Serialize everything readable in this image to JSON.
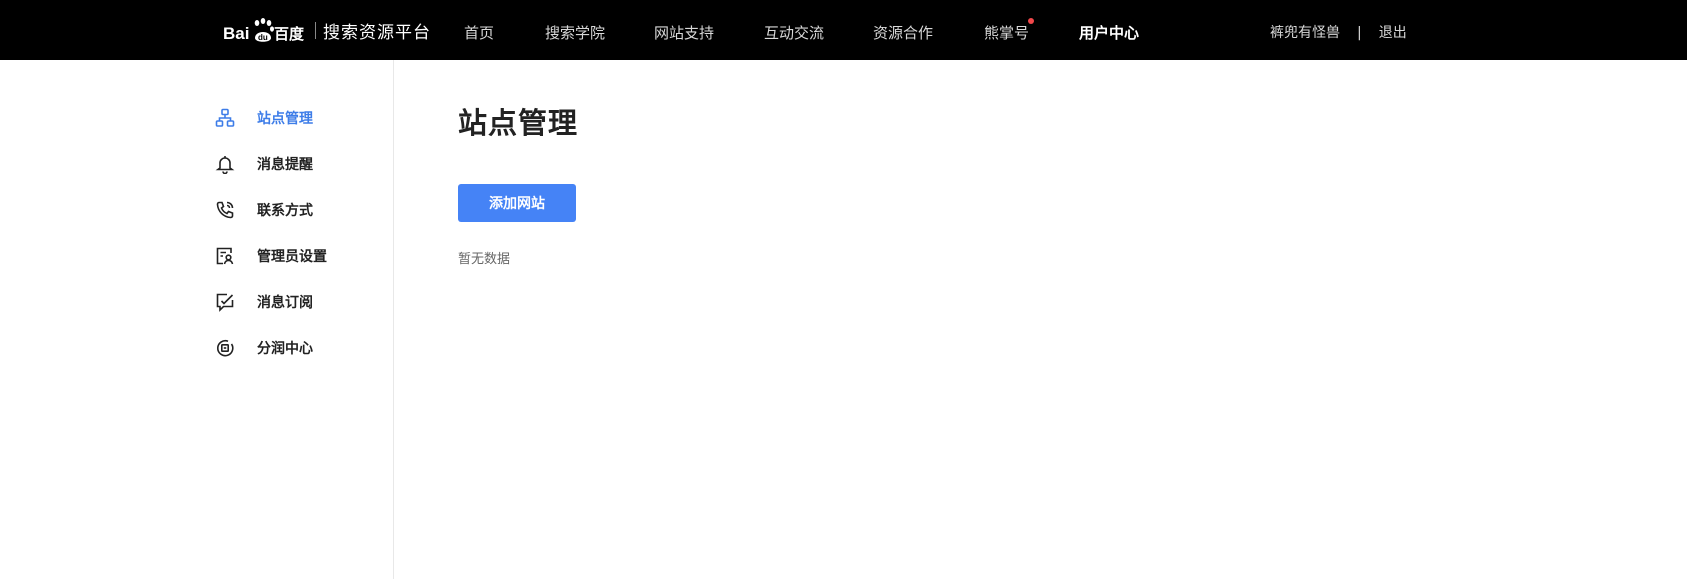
{
  "header": {
    "logo_text": "Bai百度",
    "platform_title": "搜索资源平台",
    "nav": [
      {
        "label": "首页"
      },
      {
        "label": "搜索学院"
      },
      {
        "label": "网站支持"
      },
      {
        "label": "互动交流"
      },
      {
        "label": "资源合作"
      },
      {
        "label": "熊掌号",
        "has_dot": true
      },
      {
        "label": "用户中心",
        "active": true
      }
    ],
    "username": "裤兜有怪兽",
    "separator": "|",
    "logout_label": "退出",
    "dot_color": "#f2484b"
  },
  "sidebar": {
    "items": [
      {
        "label": "站点管理",
        "icon": "site-management-icon",
        "active": true
      },
      {
        "label": "消息提醒",
        "icon": "bell-icon"
      },
      {
        "label": "联系方式",
        "icon": "phone-icon"
      },
      {
        "label": "管理员设置",
        "icon": "admin-settings-icon"
      },
      {
        "label": "消息订阅",
        "icon": "message-subscribe-icon"
      },
      {
        "label": "分润中心",
        "icon": "revenue-share-icon"
      }
    ],
    "active_color": "#3e7de8"
  },
  "main": {
    "title": "站点管理",
    "add_button_label": "添加网站",
    "empty_text": "暂无数据",
    "button_color": "#4583f6"
  }
}
